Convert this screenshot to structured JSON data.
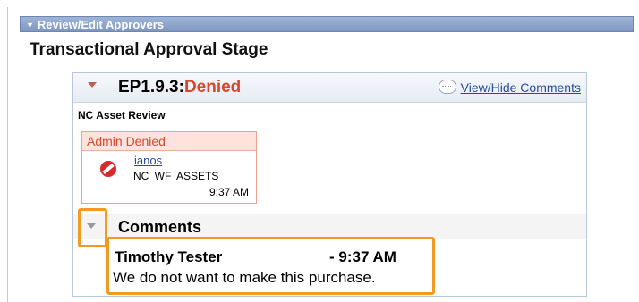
{
  "section": {
    "title": "Review/Edit Approvers"
  },
  "stage": {
    "title": "Transactional Approval Stage"
  },
  "step": {
    "id": "EP1.9.3:",
    "status": "Denied",
    "comments_link": "View/Hide Comments",
    "path_name": "NC Asset Review",
    "approver": {
      "status": "Admin Denied",
      "name": "ianos",
      "role": "NC  WF  ASSETS",
      "time": "9:37 AM",
      "status_icon": "denied-icon"
    }
  },
  "comments": {
    "title": "Comments",
    "author": "Timothy Tester",
    "time": "- 9:37 AM",
    "text": "We do not want to make this purchase."
  },
  "colors": {
    "denied": "#d9472b",
    "link": "#2a4a9a",
    "highlight": "#f39a22",
    "header": "#8aa2c9"
  }
}
